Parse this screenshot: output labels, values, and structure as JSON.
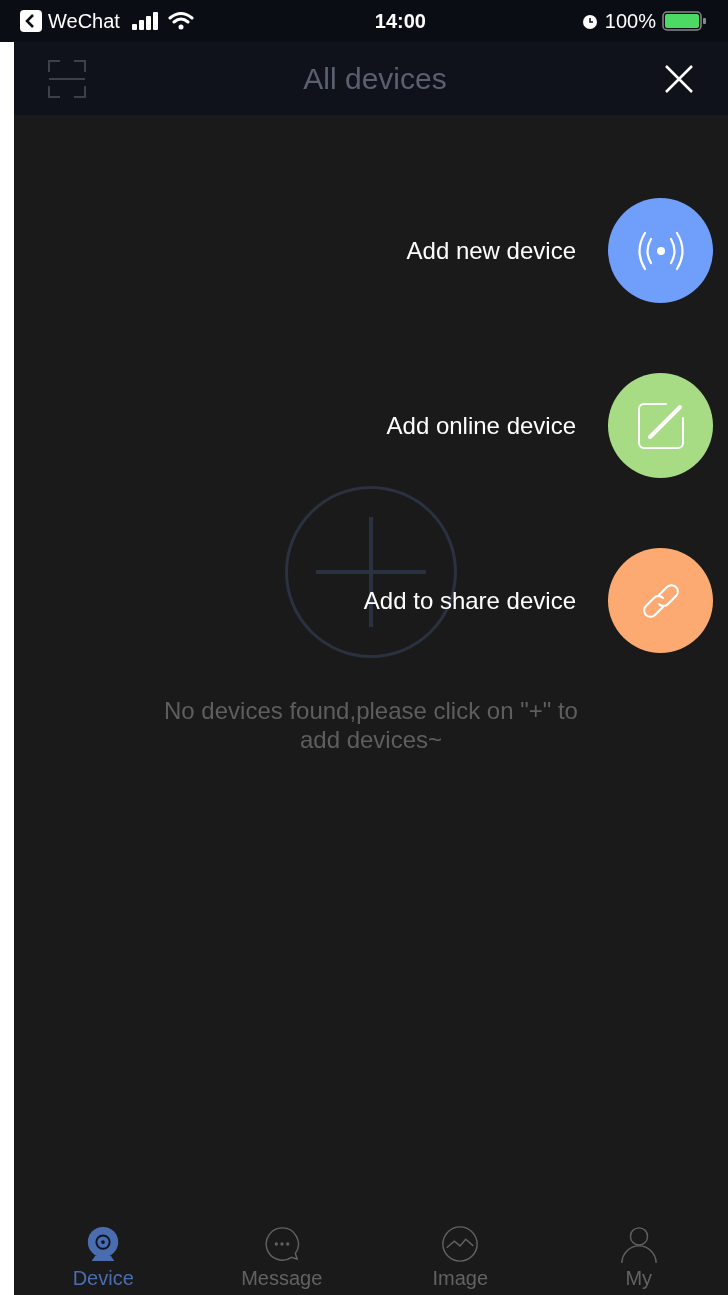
{
  "status_bar": {
    "back_app": "WeChat",
    "time": "14:00",
    "battery": "100%"
  },
  "header": {
    "title": "All devices"
  },
  "empty_state": {
    "message": "No devices found,please click on \"+\" to add devices~"
  },
  "add_menu": [
    {
      "label": "Add new device",
      "kind": "signal",
      "color": "#6f9ffb"
    },
    {
      "label": "Add online device",
      "kind": "edit",
      "color": "#a8dc84"
    },
    {
      "label": "Add to share device",
      "kind": "link",
      "color": "#fcaa72"
    }
  ],
  "tabs": [
    {
      "label": "Device",
      "kind": "camera",
      "selected": true
    },
    {
      "label": "Message",
      "kind": "chat",
      "selected": false
    },
    {
      "label": "Image",
      "kind": "image",
      "selected": false
    },
    {
      "label": "My",
      "kind": "person",
      "selected": false
    }
  ]
}
